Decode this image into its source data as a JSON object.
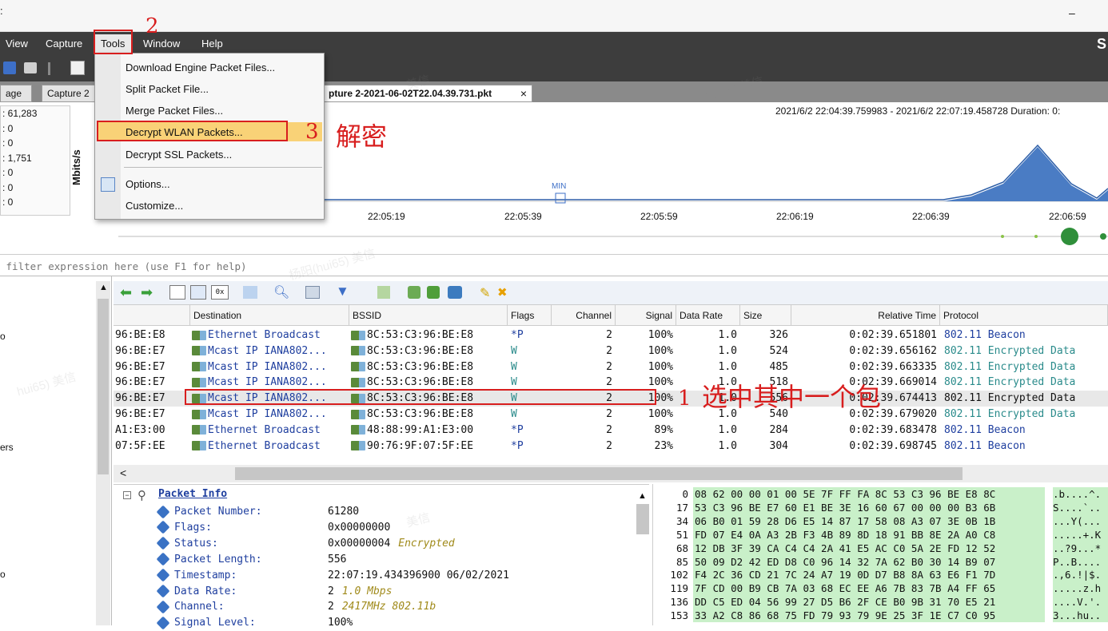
{
  "window": {
    "minimize": "–",
    "brand": "S"
  },
  "menu": {
    "view": "View",
    "capture": "Capture",
    "tools": "Tools",
    "window": "Window",
    "help": "Help"
  },
  "tabs": {
    "page": "age",
    "capture2": "Capture 2",
    "capture_file": "pture 2-2021-06-02T22.04.39.731.pkt",
    "close": "×"
  },
  "stats": ": 61,283|: 0|: 0|: 1,751|: 0|: 0|: 0",
  "graph": {
    "range": "2021/6/2 22:04:39.759983 - 2021/6/2 22:07:19.458728  Duration: 0:",
    "ylabel": "Mbits/s",
    "min_label": "MIN",
    "ticks": [
      "22:05:19",
      "22:05:39",
      "22:05:59",
      "22:06:19",
      "22:06:39",
      "22:06:59"
    ]
  },
  "filter": {
    "placeholder": " filter expression here (use F1 for help)"
  },
  "left_labels": {
    "a": "o",
    "b": "ers",
    "c": "o"
  },
  "columns": [
    "Destination",
    "BSSID",
    "Flags",
    "Channel",
    "Signal",
    "Data Rate",
    "Size",
    "Relative Time",
    "Protocol"
  ],
  "rows": [
    {
      "src": "96:BE:E8",
      "dst": "Ethernet Broadcast",
      "bssid": "8C:53:C3:96:BE:E8",
      "flags": "*P",
      "ch": "2",
      "sig": "100%",
      "rate": "1.0",
      "size": "326",
      "time": "0:02:39.651801",
      "proto": "802.11 Beacon",
      "type": "beacon"
    },
    {
      "src": "96:BE:E7",
      "dst": "Mcast IP IANA802...",
      "bssid": "8C:53:C3:96:BE:E8",
      "flags": "W",
      "ch": "2",
      "sig": "100%",
      "rate": "1.0",
      "size": "524",
      "time": "0:02:39.656162",
      "proto": "802.11 Encrypted Data",
      "type": "enc"
    },
    {
      "src": "96:BE:E7",
      "dst": "Mcast IP IANA802...",
      "bssid": "8C:53:C3:96:BE:E8",
      "flags": "W",
      "ch": "2",
      "sig": "100%",
      "rate": "1.0",
      "size": "485",
      "time": "0:02:39.663335",
      "proto": "802.11 Encrypted Data",
      "type": "enc"
    },
    {
      "src": "96:BE:E7",
      "dst": "Mcast IP IANA802...",
      "bssid": "8C:53:C3:96:BE:E8",
      "flags": "W",
      "ch": "2",
      "sig": "100%",
      "rate": "1.0",
      "size": "518",
      "time": "0:02:39.669014",
      "proto": "802.11 Encrypted Data",
      "type": "enc"
    },
    {
      "src": "96:BE:E7",
      "dst": "Mcast IP IANA802...",
      "bssid": "8C:53:C3:96:BE:E8",
      "flags": "W",
      "ch": "2",
      "sig": "100%",
      "rate": "1.0",
      "size": "556",
      "time": "0:02:39.674413",
      "proto": "802.11 Encrypted Data",
      "type": "selected"
    },
    {
      "src": "96:BE:E7",
      "dst": "Mcast IP IANA802...",
      "bssid": "8C:53:C3:96:BE:E8",
      "flags": "W",
      "ch": "2",
      "sig": "100%",
      "rate": "1.0",
      "size": "540",
      "time": "0:02:39.679020",
      "proto": "802.11 Encrypted Data",
      "type": "enc"
    },
    {
      "src": "A1:E3:00",
      "dst": "Ethernet Broadcast",
      "bssid": "48:88:99:A1:E3:00",
      "flags": "*P",
      "ch": "2",
      "sig": "89%",
      "rate": "1.0",
      "size": "284",
      "time": "0:02:39.683478",
      "proto": "802.11 Beacon",
      "type": "beacon"
    },
    {
      "src": "07:5F:EE",
      "dst": "Ethernet Broadcast",
      "bssid": "90:76:9F:07:5F:EE",
      "flags": "*P",
      "ch": "2",
      "sig": "23%",
      "rate": "1.0",
      "size": "304",
      "time": "0:02:39.698745",
      "proto": "802.11 Beacon",
      "type": "beacon"
    }
  ],
  "hscroll": {
    "left": "<"
  },
  "detail": {
    "title": "Packet Info",
    "fields": [
      {
        "k": "Packet Number:",
        "v": "61280",
        "x": ""
      },
      {
        "k": "Flags:",
        "v": "0x00000000",
        "x": ""
      },
      {
        "k": "Status:",
        "v": "0x00000004",
        "x": "Encrypted"
      },
      {
        "k": "Packet Length:",
        "v": "556",
        "x": ""
      },
      {
        "k": "Timestamp:",
        "v": "22:07:19.434396900 06/02/2021",
        "x": ""
      },
      {
        "k": "Data Rate:",
        "v": "2",
        "x": "1.0 Mbps"
      },
      {
        "k": "Channel:",
        "v": "2",
        "x": "2417MHz  802.11b"
      },
      {
        "k": "Signal Level:",
        "v": "100%",
        "x": ""
      }
    ]
  },
  "hex": [
    {
      "off": "0",
      "bytes": "08 62 00 00 01 00 5E 7F FF FA 8C 53 C3 96 BE E8 8C",
      "ascii": ".b....^."
    },
    {
      "off": "17",
      "bytes": "53 C3 96 BE E7 60 E1 BE 3E 16 60 67 00 00 00 B3 6B",
      "ascii": "S....`.."
    },
    {
      "off": "34",
      "bytes": "06 B0 01 59 28 D6 E5 14 87 17 58 08 A3 07 3E 0B 1B",
      "ascii": "...Y(..."
    },
    {
      "off": "51",
      "bytes": "FD 07 E4 0A A3 2B F3 4B 89 8D 18 91 BB 8E 2A A0 C8",
      "ascii": ".....+.K"
    },
    {
      "off": "68",
      "bytes": "12 DB 3F 39 CA C4 C4 2A 41 E5 AC C0 5A 2E FD 12 52",
      "ascii": "..?9...*"
    },
    {
      "off": "85",
      "bytes": "50 09 D2 42 ED D8 C0 96 14 32 7A 62 B0 30 14 B9 07",
      "ascii": "P..B...."
    },
    {
      "off": "102",
      "bytes": "F4 2C 36 CD 21 7C 24 A7 19 0D D7 B8 8A 63 E6 F1 7D",
      "ascii": ".,6.!|$."
    },
    {
      "off": "119",
      "bytes": "7F CD 00 B9 CB 7A 03 68 EC EE A6 7B 83 7B A4 FF 65",
      "ascii": ".....z.h"
    },
    {
      "off": "136",
      "bytes": "DD C5 ED 04 56 99 27 D5 B6 2F CE B0 9B 31 70 E5 21",
      "ascii": "....V.'."
    },
    {
      "off": "153",
      "bytes": "33 A2 C8 86 68 75 FD 79 93 79 9E 25 3F 1E C7 C0 95",
      "ascii": "3...hu.."
    }
  ],
  "tools_menu": {
    "items": [
      "Download Engine Packet Files...",
      "Split Packet File...",
      "Merge Packet Files...",
      "Decrypt WLAN Packets...",
      "Decrypt SSL Packets...",
      "Options...",
      "Customize..."
    ]
  },
  "annotations": {
    "n1": "1",
    "t1": "选中其中一个包",
    "n2": "2",
    "n3": "3",
    "t3": "解密"
  },
  "watermarks": [
    "美信",
    "hui65) 美信",
    "杨阳(hui65) 美信",
    "hui65) 美信",
    "美信"
  ],
  "colors": {
    "menubar": "#3d3d3d",
    "annotation": "#d81e1e",
    "protocol_blue": "#1f3f9f",
    "protocol_teal": "#2a8b8b",
    "hex_highlight": "#c9f0c9",
    "graph_fill": "#4a7cc4"
  }
}
